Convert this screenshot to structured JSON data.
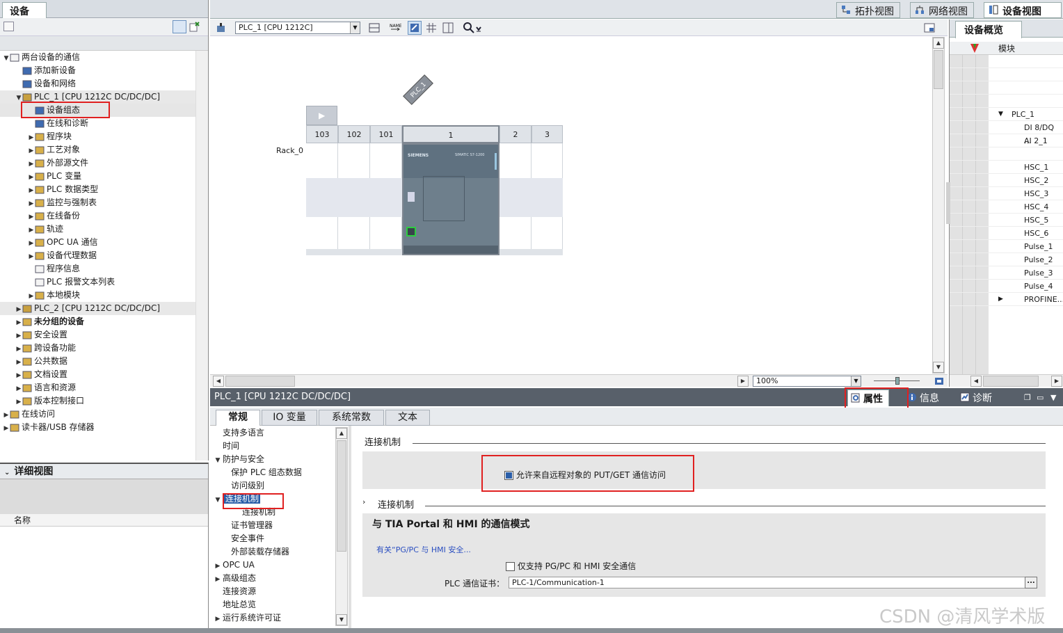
{
  "left_panel": {
    "tab": "设备",
    "tree": [
      {
        "label": "两台设备的通信",
        "indent": 0,
        "expander": "▼",
        "icon": "project"
      },
      {
        "label": "添加新设备",
        "indent": 1,
        "expander": "",
        "icon": "add-device"
      },
      {
        "label": "设备和网络",
        "indent": 1,
        "expander": "",
        "icon": "network"
      },
      {
        "label": "PLC_1 [CPU 1212C DC/DC/DC]",
        "indent": 1,
        "expander": "▼",
        "icon": "plc",
        "style": "hl"
      },
      {
        "label": "设备组态",
        "indent": 2,
        "expander": "",
        "icon": "device-config",
        "style": "sel"
      },
      {
        "label": "在线和诊断",
        "indent": 2,
        "expander": "",
        "icon": "diagnostics"
      },
      {
        "label": "程序块",
        "indent": 2,
        "expander": "▶",
        "icon": "folder"
      },
      {
        "label": "工艺对象",
        "indent": 2,
        "expander": "▶",
        "icon": "folder"
      },
      {
        "label": "外部源文件",
        "indent": 2,
        "expander": "▶",
        "icon": "folder"
      },
      {
        "label": "PLC 变量",
        "indent": 2,
        "expander": "▶",
        "icon": "folder"
      },
      {
        "label": "PLC 数据类型",
        "indent": 2,
        "expander": "▶",
        "icon": "folder"
      },
      {
        "label": "监控与强制表",
        "indent": 2,
        "expander": "▶",
        "icon": "folder"
      },
      {
        "label": "在线备份",
        "indent": 2,
        "expander": "▶",
        "icon": "folder"
      },
      {
        "label": "轨迹",
        "indent": 2,
        "expander": "▶",
        "icon": "folder"
      },
      {
        "label": "OPC UA 通信",
        "indent": 2,
        "expander": "▶",
        "icon": "folder"
      },
      {
        "label": "设备代理数据",
        "indent": 2,
        "expander": "▶",
        "icon": "folder"
      },
      {
        "label": "程序信息",
        "indent": 2,
        "expander": "",
        "icon": "doc"
      },
      {
        "label": "PLC 报警文本列表",
        "indent": 2,
        "expander": "",
        "icon": "doc"
      },
      {
        "label": "本地模块",
        "indent": 2,
        "expander": "▶",
        "icon": "folder"
      },
      {
        "label": "PLC_2 [CPU 1212C DC/DC/DC]",
        "indent": 1,
        "expander": "▶",
        "icon": "plc",
        "style": "hl"
      },
      {
        "label": "未分组的设备",
        "indent": 1,
        "expander": "▶",
        "icon": "folder",
        "style": "bold"
      },
      {
        "label": "安全设置",
        "indent": 1,
        "expander": "▶",
        "icon": "folder"
      },
      {
        "label": "跨设备功能",
        "indent": 1,
        "expander": "▶",
        "icon": "folder"
      },
      {
        "label": "公共数据",
        "indent": 1,
        "expander": "▶",
        "icon": "folder"
      },
      {
        "label": "文档设置",
        "indent": 1,
        "expander": "▶",
        "icon": "folder"
      },
      {
        "label": "语言和资源",
        "indent": 1,
        "expander": "▶",
        "icon": "folder"
      },
      {
        "label": "版本控制接口",
        "indent": 1,
        "expander": "▶",
        "icon": "folder"
      },
      {
        "label": "在线访问",
        "indent": 0,
        "expander": "▶",
        "icon": "folder"
      },
      {
        "label": "读卡器/USB 存储器",
        "indent": 0,
        "expander": "▶",
        "icon": "folder"
      }
    ]
  },
  "detail_view": {
    "title": "详细视图",
    "column_name": "名称"
  },
  "view_tabs": {
    "topology": "拓扑视图",
    "network": "网络视图",
    "device": "设备视图"
  },
  "center": {
    "device_select": "PLC_1 [CPU 1212C]",
    "plc_tag": "PLC_1",
    "rack_label": "Rack_0",
    "slots": [
      "103",
      "102",
      "101",
      "1",
      "2",
      "3"
    ],
    "zoom": "100%",
    "cpu_brand": "SIEMENS",
    "cpu_model_text": "SIMATIC S7-1200"
  },
  "overview": {
    "tab": "设备概览",
    "column_module": "模块",
    "rows": [
      {
        "label": "",
        "expander": ""
      },
      {
        "label": "",
        "expander": ""
      },
      {
        "label": "",
        "expander": ""
      },
      {
        "label": "",
        "expander": ""
      },
      {
        "label": "PLC_1",
        "expander": "▼"
      },
      {
        "label": "DI 8/DQ ...",
        "expander": ""
      },
      {
        "label": "AI 2_1",
        "expander": ""
      },
      {
        "label": "",
        "expander": ""
      },
      {
        "label": "HSC_1",
        "expander": ""
      },
      {
        "label": "HSC_2",
        "expander": ""
      },
      {
        "label": "HSC_3",
        "expander": ""
      },
      {
        "label": "HSC_4",
        "expander": ""
      },
      {
        "label": "HSC_5",
        "expander": ""
      },
      {
        "label": "HSC_6",
        "expander": ""
      },
      {
        "label": "Pulse_1",
        "expander": ""
      },
      {
        "label": "Pulse_2",
        "expander": ""
      },
      {
        "label": "Pulse_3",
        "expander": ""
      },
      {
        "label": "Pulse_4",
        "expander": ""
      },
      {
        "label": "PROFINE...",
        "expander": "▶"
      }
    ]
  },
  "properties": {
    "title": "PLC_1 [CPU 1212C DC/DC/DC]",
    "tabs": {
      "properties": "属性",
      "info": "信息",
      "diagnostics": "诊断"
    },
    "subtabs": [
      "常规",
      "IO 变量",
      "系统常数",
      "文本"
    ],
    "nav": [
      {
        "label": "支持多语言",
        "indent": 0,
        "expander": ""
      },
      {
        "label": "时间",
        "indent": 0,
        "expander": ""
      },
      {
        "label": "防护与安全",
        "indent": 0,
        "expander": "▼"
      },
      {
        "label": "保护 PLC 组态数据",
        "indent": 1,
        "expander": ""
      },
      {
        "label": "访问级别",
        "indent": 1,
        "expander": ""
      },
      {
        "label": "连接机制",
        "indent": 1,
        "expander": "▼",
        "selected": true
      },
      {
        "label": "连接机制",
        "indent": 2,
        "expander": ""
      },
      {
        "label": "证书管理器",
        "indent": 1,
        "expander": ""
      },
      {
        "label": "安全事件",
        "indent": 1,
        "expander": ""
      },
      {
        "label": "外部装载存储器",
        "indent": 1,
        "expander": ""
      },
      {
        "label": "OPC UA",
        "indent": 0,
        "expander": "▶"
      },
      {
        "label": "高级组态",
        "indent": 0,
        "expander": "▶"
      },
      {
        "label": "连接资源",
        "indent": 0,
        "expander": ""
      },
      {
        "label": "地址总览",
        "indent": 0,
        "expander": ""
      },
      {
        "label": "运行系统许可证",
        "indent": 0,
        "expander": "▶"
      }
    ],
    "section1_title": "连接机制",
    "put_get_label": "允许来自远程对象的 PUT/GET 通信访问",
    "put_get_checked": true,
    "section2_title": "连接机制",
    "tia_heading": "与 TIA Portal 和 HMI 的通信模式",
    "security_link": "有关“PG/PC 与 HMI 安全...",
    "only_pgpc_label": "仅支持 PG/PC 和 HMI 安全通信",
    "only_pgpc_checked": false,
    "cert_label": "PLC 通信证书：",
    "cert_value": "PLC-1/Communication-1",
    "cert_btn": "..."
  },
  "watermark": "CSDN @清风学术版",
  "colors": {
    "highlight_red": "#e02020",
    "title_bar": "#58606a",
    "selection_blue": "#2a5ea8"
  }
}
